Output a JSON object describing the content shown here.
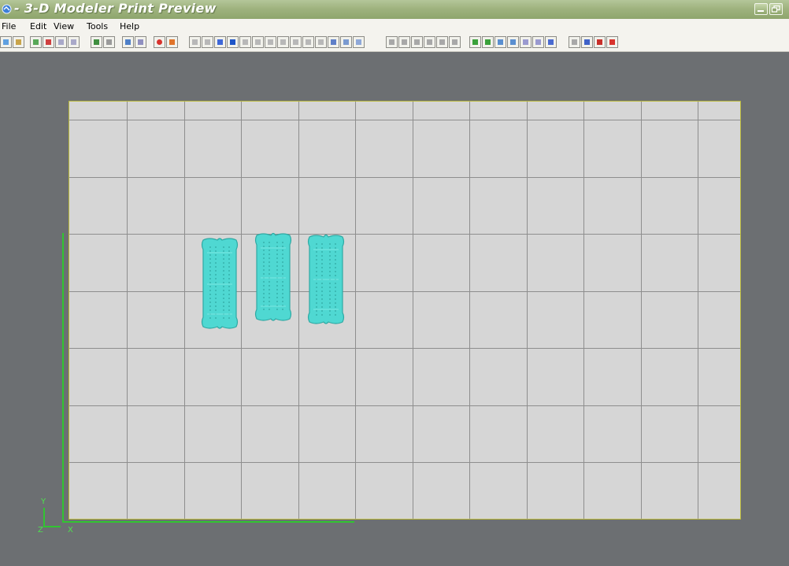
{
  "window": {
    "title": "- 3-D Modeler Print Preview"
  },
  "menu": {
    "items": [
      "File",
      "Edit",
      "View",
      "Tools",
      "Help"
    ]
  },
  "axes": {
    "x_label": "X",
    "y_label": "Y",
    "z_label": "Z"
  },
  "colors": {
    "titlebar": "#9fb37f",
    "desktop": "#6c6f72",
    "paper": "#d6d6d6",
    "part_fill": "#4fd8d2",
    "axis": "#31c431"
  },
  "icons": {
    "window": [
      "app-icon",
      "minimize-icon",
      "restore-icon"
    ],
    "parts": [
      "part-outline-1",
      "part-outline-2",
      "part-outline-3"
    ]
  }
}
